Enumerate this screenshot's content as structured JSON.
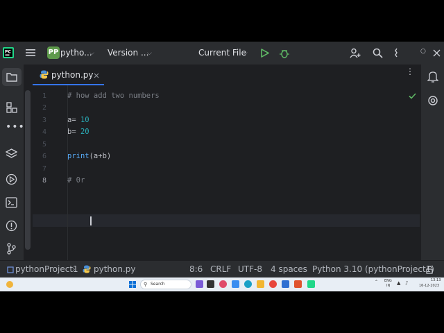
{
  "topbar": {
    "project_badge": "PP",
    "project_name": "pytho...",
    "vcs_label": "Version ...",
    "run_config": "Current File"
  },
  "editor": {
    "tab_name": "python.py",
    "lines": [
      {
        "num": "1",
        "text": "# how add two numbers"
      },
      {
        "num": "2",
        "text": ""
      },
      {
        "num": "3",
        "text_a": "a= ",
        "text_b": "10"
      },
      {
        "num": "4",
        "text_a": "b= ",
        "text_b": "20"
      },
      {
        "num": "5",
        "text": ""
      },
      {
        "num": "6",
        "text_a": "print",
        "text_b": "(a+b)"
      },
      {
        "num": "7",
        "text": ""
      },
      {
        "num": "8",
        "text": "# 0r "
      }
    ]
  },
  "statusbar": {
    "breadcrumb_project": "pythonProject1",
    "breadcrumb_file": "python.py",
    "position": "8:6",
    "line_sep": "CRLF",
    "encoding": "UTF-8",
    "indent": "4 spaces",
    "interpreter": "Python 3.10 (pythonProject1)"
  },
  "taskbar": {
    "search_placeholder": "Search",
    "lang_top": "ENG",
    "lang_bottom": "IN",
    "time": "13:13",
    "date": "16-12-2023"
  },
  "colors": {
    "accent": "#3574f0",
    "run_green": "#5fb865",
    "badge_green": "#5e9a4b"
  }
}
